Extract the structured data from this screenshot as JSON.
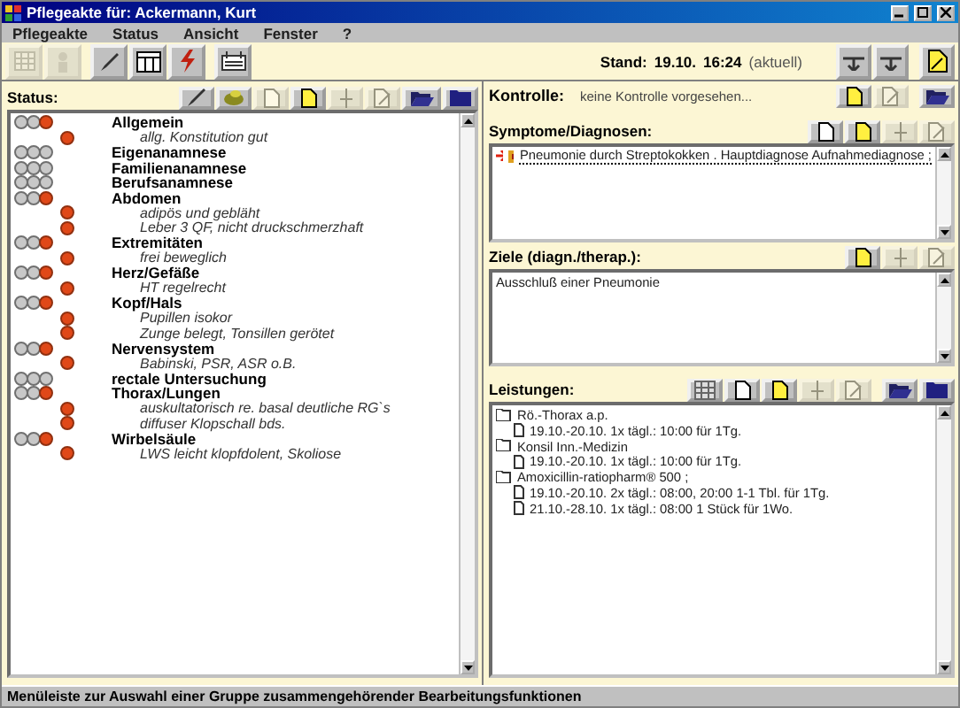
{
  "window": {
    "title": "Pflegeakte für: Ackermann, Kurt"
  },
  "menu": [
    "Pflegeakte",
    "Status",
    "Ansicht",
    "Fenster",
    "?"
  ],
  "toolbar": [
    {
      "kind": "grid",
      "disabled": true
    },
    {
      "kind": "person",
      "disabled": true
    },
    {
      "kind": "pen",
      "disabled": false
    },
    {
      "kind": "table",
      "disabled": false
    },
    {
      "kind": "flash",
      "disabled": false
    },
    {
      "kind": "calendar",
      "disabled": false
    }
  ],
  "stand": {
    "label": "Stand:",
    "date": "19.10.",
    "time": "16:24",
    "note": "(aktuell)"
  },
  "stand_buttons": [
    {
      "kind": "arrow-down",
      "disabled": false
    },
    {
      "kind": "arrow-down",
      "disabled": false
    },
    {
      "kind": "note",
      "disabled": false
    }
  ],
  "status": {
    "title": "Status:",
    "buttons": [
      {
        "kind": "pen",
        "disabled": false
      },
      {
        "kind": "plant",
        "disabled": false
      },
      {
        "kind": "page",
        "disabled": true
      },
      {
        "kind": "new-page",
        "disabled": false
      },
      {
        "kind": "cut",
        "disabled": true
      },
      {
        "kind": "edit-page",
        "disabled": true
      },
      {
        "kind": "folder-open",
        "disabled": false
      },
      {
        "kind": "folder",
        "disabled": false
      }
    ],
    "sections": [
      {
        "label": "Allgemein",
        "flagged": true,
        "children": [
          {
            "label": "allg. Konstitution gut"
          }
        ]
      },
      {
        "label": "Eigenanamnese",
        "flagged": false
      },
      {
        "label": "Familienanamnese",
        "flagged": false
      },
      {
        "label": "Berufsanamnese",
        "flagged": false
      },
      {
        "label": "Abdomen",
        "flagged": true,
        "children": [
          {
            "label": "adipös und gebläht"
          },
          {
            "label": "Leber 3 QF, nicht druckschmerzhaft"
          }
        ]
      },
      {
        "label": "Extremitäten",
        "flagged": true,
        "children": [
          {
            "label": "frei beweglich"
          }
        ]
      },
      {
        "label": "Herz/Gefäße",
        "flagged": true,
        "children": [
          {
            "label": "HT regelrecht"
          }
        ]
      },
      {
        "label": "Kopf/Hals",
        "flagged": true,
        "children": [
          {
            "label": "Pupillen isokor"
          },
          {
            "label": "Zunge belegt, Tonsillen gerötet"
          }
        ]
      },
      {
        "label": "Nervensystem",
        "flagged": true,
        "children": [
          {
            "label": "Babinski, PSR, ASR o.B."
          }
        ]
      },
      {
        "label": "rectale Untersuchung",
        "flagged": false
      },
      {
        "label": "Thorax/Lungen",
        "flagged": true,
        "children": [
          {
            "label": "auskultatorisch re. basal deutliche RG`s"
          },
          {
            "label": "diffuser Klopschall bds."
          }
        ]
      },
      {
        "label": "Wirbelsäule",
        "flagged": true,
        "children": [
          {
            "label": "LWS leicht klopfdolent, Skoliose"
          }
        ]
      }
    ]
  },
  "kontrolle": {
    "label": "Kontrolle:",
    "value": "keine Kontrolle vorgesehen...",
    "buttons": [
      {
        "kind": "new-page",
        "disabled": false
      },
      {
        "kind": "edit-page",
        "disabled": true
      },
      {
        "kind": "folder-open",
        "disabled": false
      }
    ]
  },
  "symptome": {
    "title": "Symptome/Diagnosen:",
    "buttons": [
      {
        "kind": "page",
        "disabled": false
      },
      {
        "kind": "new-page",
        "disabled": false
      },
      {
        "kind": "cut",
        "disabled": true
      },
      {
        "kind": "edit-page",
        "disabled": true
      }
    ],
    "items": [
      {
        "text": "Pneumonie durch Streptokokken . Hauptdiagnose Aufnahmediagnose ;"
      }
    ]
  },
  "ziele": {
    "title": "Ziele (diagn./therap.):",
    "buttons": [
      {
        "kind": "new-page",
        "disabled": false
      },
      {
        "kind": "cut",
        "disabled": true
      },
      {
        "kind": "edit-page",
        "disabled": true
      }
    ],
    "items": [
      {
        "text": "Ausschluß einer Pneumonie"
      }
    ]
  },
  "leistungen": {
    "title": "Leistungen:",
    "buttons": [
      {
        "kind": "grid",
        "disabled": false
      },
      {
        "kind": "page",
        "disabled": false
      },
      {
        "kind": "new-page",
        "disabled": false
      },
      {
        "kind": "cut",
        "disabled": true
      },
      {
        "kind": "edit-page",
        "disabled": true
      },
      {
        "kind": "folder-open",
        "disabled": false
      },
      {
        "kind": "folder",
        "disabled": false
      }
    ],
    "groups": [
      {
        "label": "Rö.-Thorax a.p.",
        "children": [
          {
            "label": "19.10.-20.10. 1x tägl.: 10:00 für 1Tg."
          }
        ]
      },
      {
        "label": "Konsil Inn.-Medizin",
        "children": [
          {
            "label": "19.10.-20.10. 1x tägl.: 10:00 für 1Tg."
          }
        ]
      },
      {
        "label": "Amoxicillin-ratiopharm® 500 ;",
        "children": [
          {
            "label": "19.10.-20.10. 2x tägl.: 08:00, 20:00 1-1 Tbl. für 1Tg."
          },
          {
            "label": "21.10.-28.10. 1x tägl.: 08:00 1 Stück für 1Wo."
          }
        ]
      }
    ]
  },
  "status_bar": "Menüleiste zur Auswahl einer Gruppe zusammengehörender Bearbeitungsfunktionen"
}
